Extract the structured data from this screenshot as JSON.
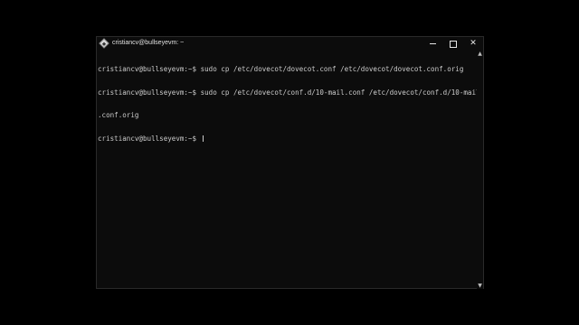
{
  "window": {
    "title": "cristiancv@bullseyevm: ~",
    "buttons": {
      "minimize": "",
      "maximize": "",
      "close": "✕"
    }
  },
  "terminal": {
    "lines": [
      "cristiancv@bullseyevm:~$ sudo cp /etc/dovecot/dovecot.conf /etc/dovecot/dovecot.conf.orig",
      "cristiancv@bullseyevm:~$ sudo cp /etc/dovecot/conf.d/10-mail.conf /etc/dovecot/conf.d/10-mail",
      ".conf.orig",
      "cristiancv@bullseyevm:~$ "
    ]
  },
  "scrollbar": {
    "up": "▲",
    "down": "▼"
  },
  "colors": {
    "background": "#0c0c0c",
    "text": "#cccccc",
    "desktop": "#000000"
  },
  "icons": {
    "app": "terminal-penguin-diamond-icon",
    "minimize": "minimize-icon",
    "maximize": "maximize-icon",
    "close": "close-icon"
  }
}
